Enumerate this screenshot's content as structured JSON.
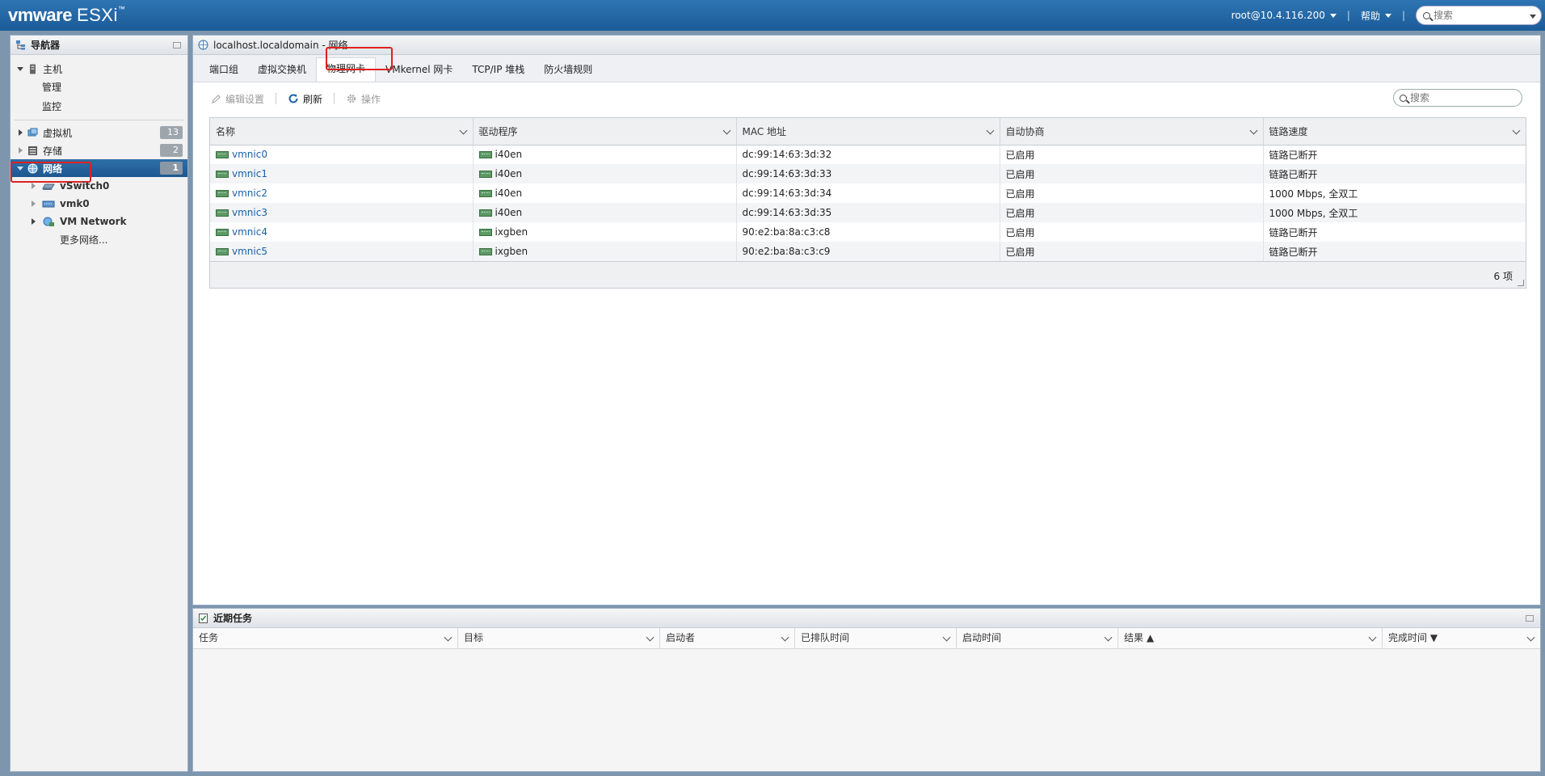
{
  "header": {
    "brand_vm": "vmware",
    "brand_esxi": "ESXi",
    "user": "root@10.4.116.200",
    "help": "帮助",
    "search_placeholder": "搜索"
  },
  "navigator": {
    "title": "导航器",
    "host": {
      "label": "主机",
      "children": [
        "管理",
        "监控"
      ]
    },
    "items": [
      {
        "label": "虚拟机",
        "badge": "13"
      },
      {
        "label": "存储",
        "badge": "2"
      },
      {
        "label": "网络",
        "badge": "1"
      }
    ],
    "network_children": [
      "vSwitch0",
      "vmk0",
      "VM Network",
      "更多网络..."
    ]
  },
  "main": {
    "title": "localhost.localdomain - 网络",
    "tabs": [
      "端口组",
      "虚拟交换机",
      "物理网卡",
      "VMkernel 网卡",
      "TCP/IP 堆栈",
      "防火墙规则"
    ],
    "active_tab": "物理网卡",
    "toolbar": {
      "edit": "编辑设置",
      "refresh": "刷新",
      "actions": "操作"
    },
    "search_placeholder": "搜索",
    "columns": [
      "名称",
      "驱动程序",
      "MAC 地址",
      "自动协商",
      "链路速度"
    ],
    "rows": [
      [
        "vmnic0",
        "i40en",
        "dc:99:14:63:3d:32",
        "已启用",
        "链路已断开"
      ],
      [
        "vmnic1",
        "i40en",
        "dc:99:14:63:3d:33",
        "已启用",
        "链路已断开"
      ],
      [
        "vmnic2",
        "i40en",
        "dc:99:14:63:3d:34",
        "已启用",
        "1000 Mbps, 全双工"
      ],
      [
        "vmnic3",
        "i40en",
        "dc:99:14:63:3d:35",
        "已启用",
        "1000 Mbps, 全双工"
      ],
      [
        "vmnic4",
        "ixgben",
        "90:e2:ba:8a:c3:c8",
        "已启用",
        "链路已断开"
      ],
      [
        "vmnic5",
        "ixgben",
        "90:e2:ba:8a:c3:c9",
        "已启用",
        "链路已断开"
      ]
    ],
    "count": "6 项"
  },
  "tasks": {
    "title": "近期任务",
    "columns": [
      "任务",
      "目标",
      "启动者",
      "已排队时间",
      "启动时间",
      "结果 ▲",
      "完成时间 ▼"
    ]
  },
  "colors": {
    "topbar": "#1f64a5",
    "active_nav": "#225f98",
    "highlight": "#e02020",
    "link": "#1a5fa8"
  }
}
